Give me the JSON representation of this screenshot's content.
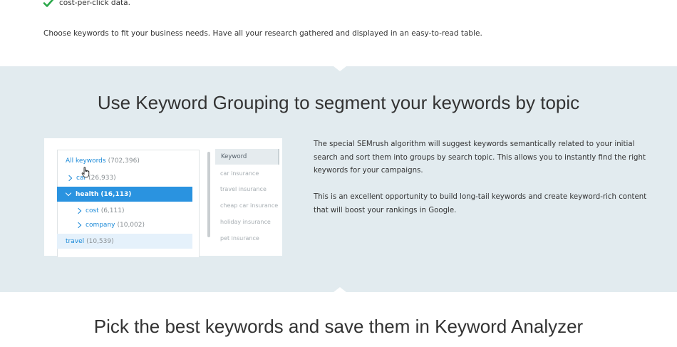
{
  "intro": {
    "check_text": "cost-per-click data.",
    "paragraph": "Choose keywords to fit your business needs. Have all your research gathered and displayed in an easy-to-read table."
  },
  "grouping_section": {
    "heading": "Use Keyword Grouping to segment your keywords by topic",
    "paragraph_1": "The special SEMrush algorithm will suggest keywords semantically related to your initial search and sort them into groups by search topic. This allows you to instantly find the right keywords for your campaigns.",
    "paragraph_2": "This is an excellent opportunity to build long-tail keywords and create keyword-rich content that will  boost your rankings in Google."
  },
  "tree": {
    "all": {
      "label": "All keywords",
      "count": "(702,396)"
    },
    "car": {
      "label": "car",
      "count": "(26,933)"
    },
    "health": {
      "label": "health",
      "count": "(16,113)"
    },
    "cost": {
      "label": "cost",
      "count": "(6,111)"
    },
    "company": {
      "label": "company",
      "count": "(10,002)"
    },
    "travel": {
      "label": "travel",
      "count": "(10,539)"
    }
  },
  "keyword_panel": {
    "header": "Keyword",
    "items": [
      "car insurance",
      "travel insurance",
      "cheap car insurance",
      "holiday insurance",
      "pet insurance"
    ]
  },
  "analyzer_section": {
    "heading": "Pick the best keywords and save them in Keyword Analyzer"
  },
  "colors": {
    "accent": "#2a93e0",
    "link": "#1c8ad8",
    "band": "#e2ebef",
    "check": "#2ba84a"
  },
  "icons": [
    "checkmark-icon",
    "chevron-right-icon",
    "chevron-down-icon",
    "hand-cursor-icon"
  ]
}
